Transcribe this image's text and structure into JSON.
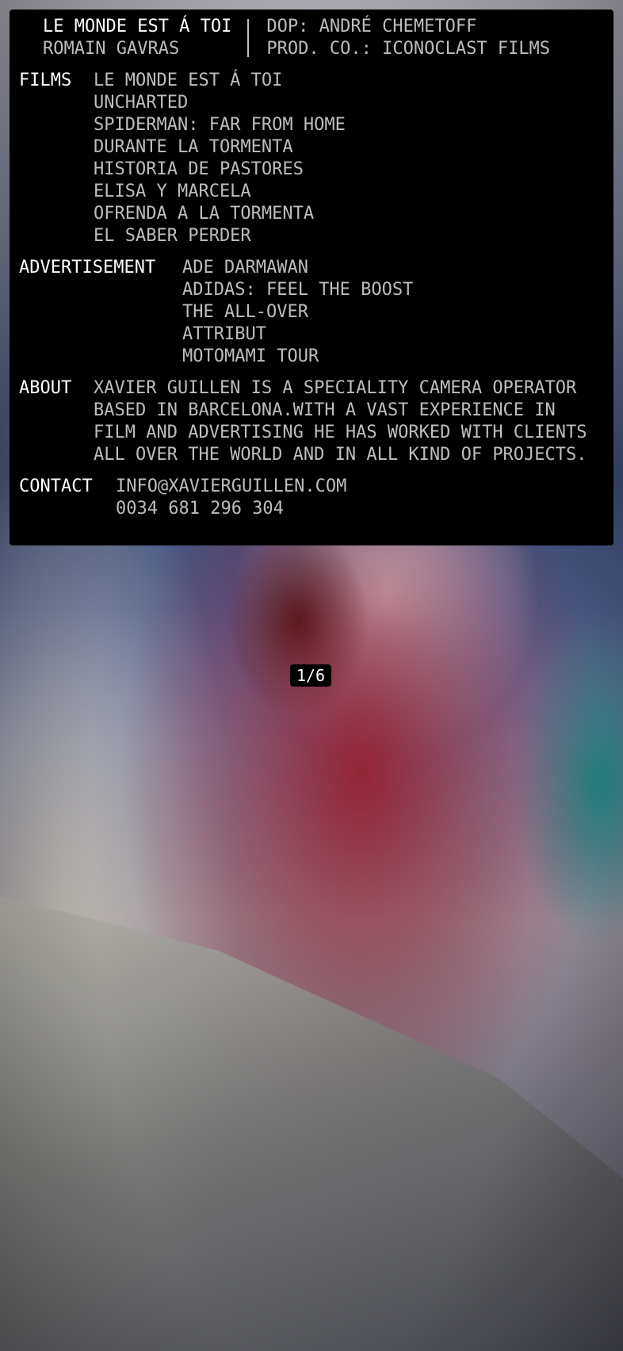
{
  "project": {
    "title": "LE MONDE EST Á TOI",
    "director": "ROMAIN GAVRAS",
    "dop": "DOP: ANDRÉ CHEMETOFF",
    "prod": "PROD. CO.: ICONOCLAST FILMS"
  },
  "films": {
    "label": "FILMS",
    "items": [
      "LE MONDE EST Á TOI",
      "UNCHARTED",
      "SPIDERMAN: FAR FROM HOME",
      "DURANTE LA TORMENTA",
      "HISTORIA DE PASTORES",
      "ELISA Y MARCELA",
      "OFRENDA A LA TORMENTA",
      "EL SABER PERDER"
    ]
  },
  "advertisement": {
    "label": "ADVERTISEMENT",
    "items": [
      "ADE DARMAWAN",
      "ADIDAS: FEEL THE BOOST",
      "THE ALL-OVER",
      "ATTRIBUT",
      "MOTOMAMI TOUR"
    ]
  },
  "about": {
    "label": "ABOUT",
    "text": "XAVIER GUILLEN IS A SPECIALITY CAMERA OPERATOR BASED IN BARCELONA.WITH A VAST EXPERIENCE IN FILM AND ADVERTISING HE HAS WORKED WITH CLIENTS ALL OVER THE WORLD AND IN ALL KIND OF PROJECTS."
  },
  "contact": {
    "label": "CONTACT",
    "email": "INFO@XAVIERGUILLEN.COM",
    "phone": "0034 681 296 304"
  },
  "slideshow": {
    "counter": "1/6"
  }
}
